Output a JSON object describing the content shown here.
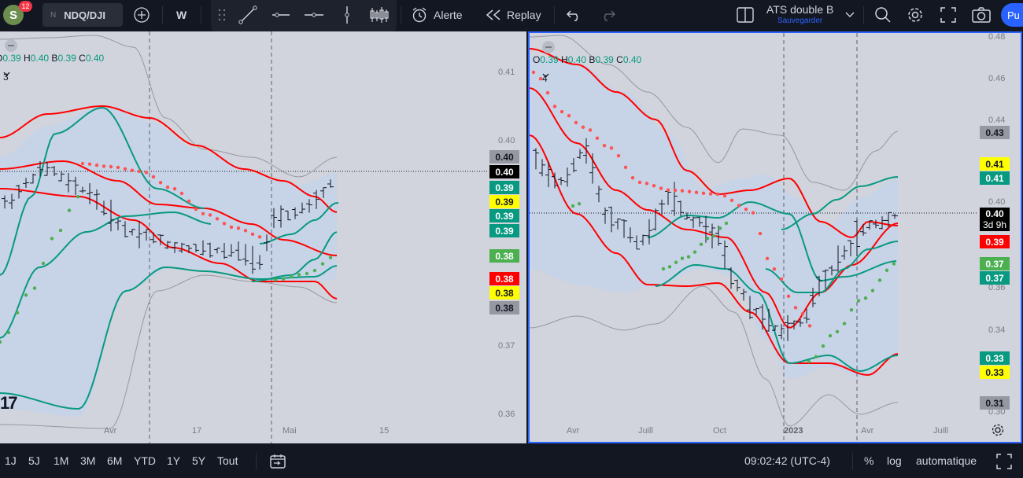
{
  "topbar": {
    "avatar_letter": "S",
    "notifications": "12",
    "symbol_exchange": "N",
    "symbol_ticker": "NDQ/DJI",
    "interval": "W",
    "alert_label": "Alerte",
    "replay_label": "Replay",
    "layout_title": "ATS double B",
    "layout_subtitle": "Sauvegarder",
    "publish_label": "Pu"
  },
  "left_pane": {
    "ohlc": {
      "o_label": "O",
      "o": "0.39",
      "h_label": "H",
      "h": "0.40",
      "l_label": "B",
      "l": "0.39",
      "c_label": "C",
      "c": "0.40"
    },
    "indicator_count": "3",
    "y_axis": [
      "0.41",
      "0.40",
      "0.37",
      "0.36"
    ],
    "x_axis": [
      "Avr",
      "17",
      "Mai",
      "15"
    ],
    "price_tags": [
      {
        "text": "0.40",
        "bg": "#9598a1",
        "fg": "#131722"
      },
      {
        "text": "0.40",
        "bg": "#000000",
        "fg": "#ffffff"
      },
      {
        "text": "0.39",
        "bg": "#089981",
        "fg": "#ffffff"
      },
      {
        "text": "0.39",
        "bg": "#ffff00",
        "fg": "#131722"
      },
      {
        "text": "0.39",
        "bg": "#089981",
        "fg": "#ffffff"
      },
      {
        "text": "0.39",
        "bg": "#089981",
        "fg": "#ffffff"
      },
      {
        "text": "0.38",
        "bg": "#4caf50",
        "fg": "#ffffff"
      },
      {
        "text": "0.38",
        "bg": "#ff0000",
        "fg": "#ffffff"
      },
      {
        "text": "0.38",
        "bg": "#ffff00",
        "fg": "#131722"
      },
      {
        "text": "0.38",
        "bg": "#9598a1",
        "fg": "#131722"
      }
    ]
  },
  "right_pane": {
    "ohlc": {
      "o_label": "O",
      "o": "0.39",
      "h_label": "H",
      "h": "0.40",
      "l_label": "B",
      "l": "0.39",
      "c_label": "C",
      "c": "0.40"
    },
    "indicator_count": "4",
    "y_axis": [
      "0.48",
      "0.46",
      "0.44",
      "0.40",
      "0.36",
      "0.34",
      "0.30"
    ],
    "x_axis": [
      "Avr",
      "Juill",
      "Oct",
      "2023",
      "Avr",
      "Juill"
    ],
    "price_tags": [
      {
        "text": "0.43",
        "bg": "#9598a1",
        "fg": "#131722"
      },
      {
        "text": "0.41",
        "bg": "#ffff00",
        "fg": "#131722"
      },
      {
        "text": "0.41",
        "bg": "#089981",
        "fg": "#ffffff"
      },
      {
        "text": "0.39",
        "bg": "#ff0000",
        "fg": "#ffffff"
      },
      {
        "text": "0.37",
        "bg": "#4caf50",
        "fg": "#ffffff"
      },
      {
        "text": "0.37",
        "bg": "#089981",
        "fg": "#ffffff"
      },
      {
        "text": "0.33",
        "bg": "#089981",
        "fg": "#ffffff"
      },
      {
        "text": "0.33",
        "bg": "#ffff00",
        "fg": "#131722"
      },
      {
        "text": "0.31",
        "bg": "#9598a1",
        "fg": "#131722"
      }
    ],
    "last_price_tag": {
      "price": "0.40",
      "countdown": "3d 9h"
    }
  },
  "bottombar": {
    "ranges": [
      "1J",
      "5J",
      "1M",
      "3M",
      "6M",
      "YTD",
      "1Y",
      "5Y",
      "Tout"
    ],
    "time": "09:02:42 (UTC-4)",
    "percent": "%",
    "log": "log",
    "auto": "automatique"
  },
  "colors": {
    "accent": "#2962ff",
    "band_red": "#ff0000",
    "band_green": "#089981",
    "sar_red": "#ff5252",
    "sar_green": "#4caf50",
    "band_fill": "#c5d3e8"
  }
}
